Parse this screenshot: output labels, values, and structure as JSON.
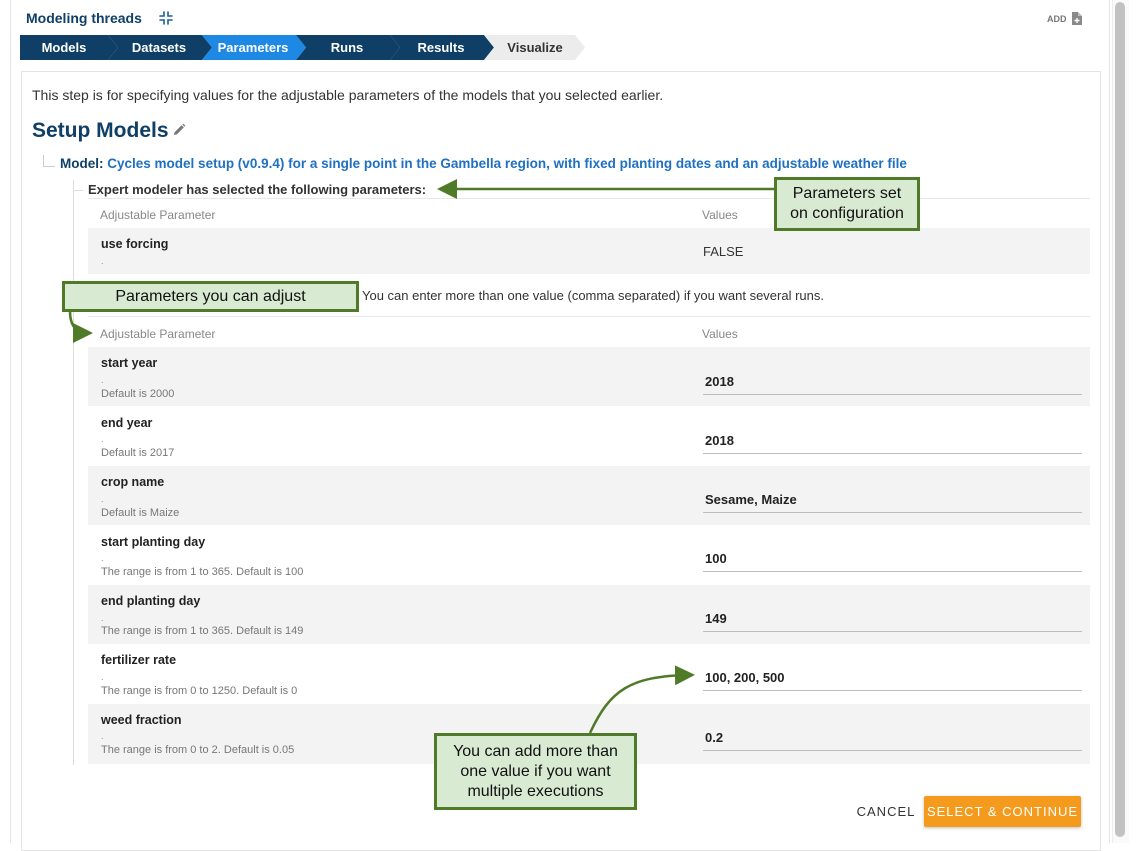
{
  "header": {
    "title": "Modeling threads",
    "add_label": "ADD"
  },
  "steps": [
    {
      "label": "Models",
      "state": "done"
    },
    {
      "label": "Datasets",
      "state": "done"
    },
    {
      "label": "Parameters",
      "state": "active"
    },
    {
      "label": "Runs",
      "state": "done"
    },
    {
      "label": "Results",
      "state": "done"
    },
    {
      "label": "Visualize",
      "state": "todo"
    }
  ],
  "colors": {
    "step_dark": "#0f3f66",
    "step_active": "#1e88e5",
    "step_todo": "#ececec",
    "accent_orange": "#f49a1d",
    "callout_fill": "#d9ead3",
    "callout_border": "#4f7a28",
    "link": "#1f70c1"
  },
  "intro": "This step is for specifying values for the adjustable parameters of the models that you selected earlier.",
  "setup_title": "Setup Models",
  "model": {
    "label": "Model:",
    "name": "Cycles model setup (v0.9.4) for a single point in the Gambella region, with fixed planting dates and an adjustable weather file"
  },
  "fixed_section": {
    "heading": "Expert modeler has selected the following parameters:",
    "col_param": "Adjustable Parameter",
    "col_values": "Values",
    "params": [
      {
        "name": "use forcing",
        "dot": ".",
        "value": "FALSE"
      }
    ]
  },
  "adjustable_section": {
    "hint": "You can enter more than one value (comma separated) if you want several runs.",
    "col_param": "Adjustable Parameter",
    "col_values": "Values",
    "params": [
      {
        "name": "start year",
        "dot": ".",
        "default": "Default is 2000",
        "value": "2018"
      },
      {
        "name": "end year",
        "dot": ".",
        "default": "Default is 2017",
        "value": "2018"
      },
      {
        "name": "crop name",
        "dot": ".",
        "default": "Default is Maize",
        "value": "Sesame, Maize"
      },
      {
        "name": "start planting day",
        "dot": ".",
        "default": "The range is from 1 to 365. Default is 100",
        "value": "100"
      },
      {
        "name": "end planting day",
        "dot": ".",
        "default": "The range is from 1 to 365. Default is 149",
        "value": "149"
      },
      {
        "name": "fertilizer rate",
        "dot": ".",
        "default": "The range is from 0 to 1250. Default is 0",
        "value": "100, 200, 500"
      },
      {
        "name": "weed fraction",
        "dot": ".",
        "default": "The range is from 0 to 2. Default is 0.05",
        "value": "0.2"
      }
    ]
  },
  "callouts": {
    "set_on_config": [
      "Parameters set",
      "on configuration"
    ],
    "can_adjust": "Parameters you can adjust",
    "multiple": [
      "You can add more than",
      "one value if you want",
      "multiple executions"
    ]
  },
  "actions": {
    "cancel": "CANCEL",
    "continue": "SELECT & CONTINUE"
  },
  "icons": {
    "collapse": "compress-arrows-icon",
    "add": "add-file-icon",
    "edit": "pencil-icon"
  }
}
